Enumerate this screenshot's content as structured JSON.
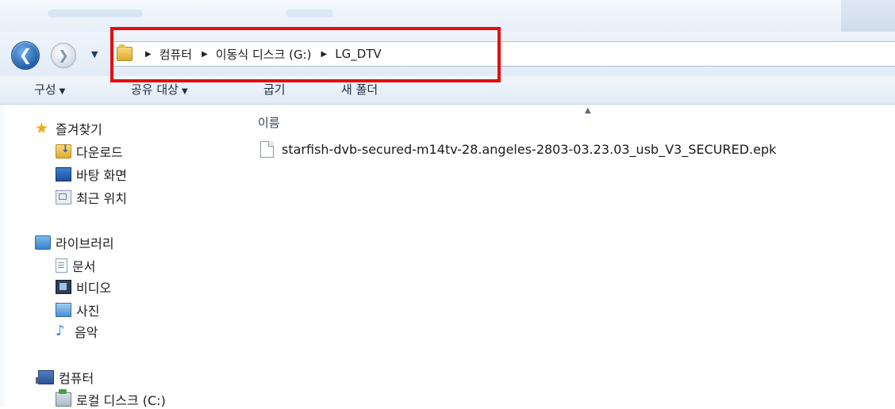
{
  "address_bar": {
    "crumbs": [
      "컴퓨터",
      "이동식 디스크 (G:)",
      "LG_DTV"
    ]
  },
  "toolbar": {
    "organize": "구성",
    "share": "공유 대상",
    "burn": "굽기",
    "new_folder": "새 폴더"
  },
  "nav": {
    "favorites": "즐겨찾기",
    "downloads": "다운로드",
    "desktop": "바탕 화면",
    "recent": "최근 위치",
    "libraries": "라이브러리",
    "documents": "문서",
    "videos": "비디오",
    "pictures": "사진",
    "music": "음악",
    "computer": "컴퓨터",
    "local_disk": "로컬 디스크 (C:)"
  },
  "content": {
    "column_name": "이름",
    "files": [
      "starfish-dvb-secured-m14tv-28.angeles-2803-03.23.03_usb_V3_SECURED.epk"
    ]
  }
}
